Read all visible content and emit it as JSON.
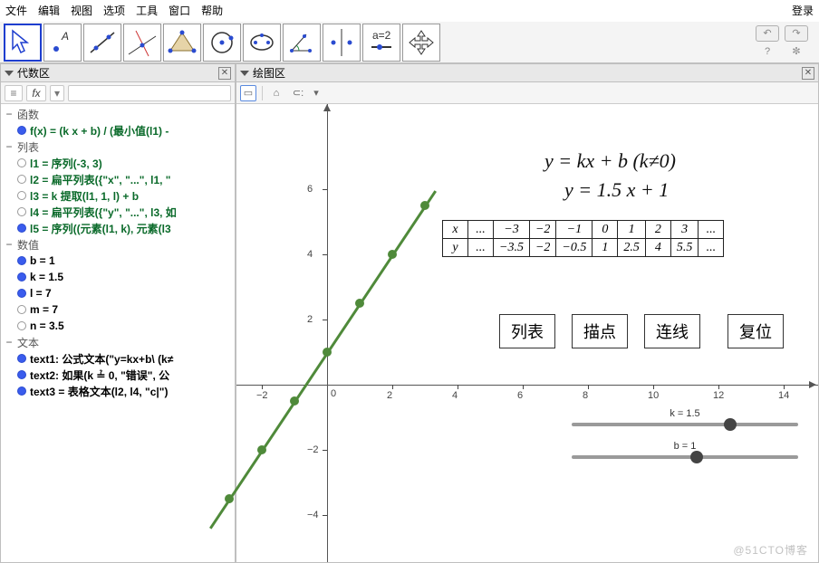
{
  "menu": {
    "items": [
      "文件",
      "编辑",
      "视图",
      "选项",
      "工具",
      "窗口",
      "帮助"
    ],
    "login": "登录"
  },
  "panels": {
    "left_title": "代数区",
    "right_title": "绘图区"
  },
  "algebra": {
    "groups": [
      {
        "name": "函数",
        "items": [
          {
            "dot": "on",
            "cls": "fn",
            "text": "f(x) = (k x + b) / (最小值(l1) -"
          }
        ]
      },
      {
        "name": "列表",
        "items": [
          {
            "dot": "off",
            "cls": "fn",
            "text": "l1 = 序列(-3, 3)"
          },
          {
            "dot": "off",
            "cls": "fn",
            "text": "l2 = 扁平列表({\"x\", \"...\", l1, \""
          },
          {
            "dot": "off",
            "cls": "fn",
            "text": "l3 = k 提取(l1, 1, l) + b"
          },
          {
            "dot": "off",
            "cls": "fn",
            "text": "l4 = 扁平列表({\"y\", \"...\", l3, 如"
          },
          {
            "dot": "on",
            "cls": "fn",
            "text": "l5 = 序列((元素(l1, k), 元素(l3"
          }
        ]
      },
      {
        "name": "数值",
        "items": [
          {
            "dot": "on",
            "cls": "",
            "text": "b = 1"
          },
          {
            "dot": "on",
            "cls": "",
            "text": "k = 1.5"
          },
          {
            "dot": "on",
            "cls": "",
            "text": "l = 7"
          },
          {
            "dot": "off",
            "cls": "",
            "text": "m = 7"
          },
          {
            "dot": "off",
            "cls": "",
            "text": "n = 3.5"
          }
        ]
      },
      {
        "name": "文本",
        "items": [
          {
            "dot": "on",
            "cls": "",
            "text": "text1: 公式文本(\"y=kx+b\\ (k≠"
          },
          {
            "dot": "on",
            "cls": "",
            "text": "text2: 如果(k ≟ 0, \"错误\", 公"
          },
          {
            "dot": "on",
            "cls": "",
            "text": "text3 = 表格文本(l2, l4, \"c|\")"
          }
        ]
      }
    ]
  },
  "formula": {
    "line1": "y = kx + b  (k≠0)",
    "line2": "y = 1.5 x + 1"
  },
  "table": {
    "row1": [
      "x",
      "...",
      "−3",
      "−2",
      "−1",
      "0",
      "1",
      "2",
      "3",
      "..."
    ],
    "row2": [
      "y",
      "...",
      "−3.5",
      "−2",
      "−0.5",
      "1",
      "2.5",
      "4",
      "5.5",
      "..."
    ]
  },
  "buttons": {
    "b1": "列表",
    "b2": "描点",
    "b3": "连线",
    "b4": "复位"
  },
  "sliders": {
    "k": {
      "label": "k = 1.5"
    },
    "b": {
      "label": "b = 1"
    }
  },
  "chart_data": {
    "type": "line",
    "title": "y = 1.5x + 1",
    "xlabel": "",
    "ylabel": "",
    "x": [
      -3,
      -2,
      -1,
      0,
      1,
      2,
      3
    ],
    "y": [
      -3.5,
      -2,
      -0.5,
      1,
      2.5,
      4,
      5.5
    ],
    "xlim": [
      -3,
      15
    ],
    "ylim": [
      -5,
      7
    ],
    "x_ticks": [
      -2,
      2,
      4,
      6,
      8,
      10,
      12,
      14
    ],
    "y_ticks": [
      -4,
      -2,
      2,
      4,
      6
    ]
  },
  "watermark": "@51CTO博客"
}
